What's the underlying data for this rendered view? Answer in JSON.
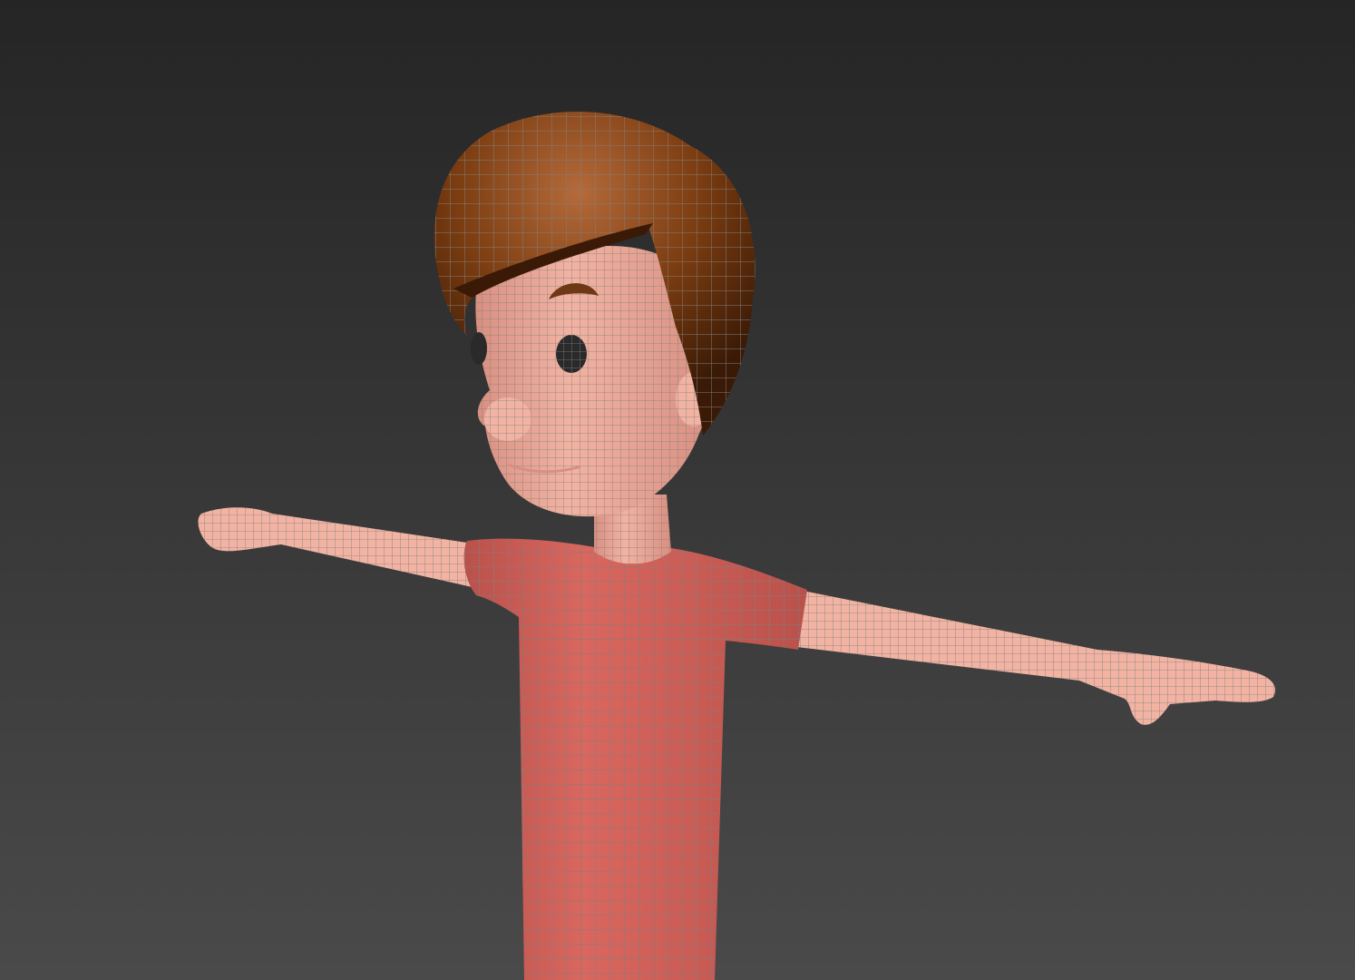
{
  "viewport": {
    "background_top": "#252525",
    "background_bottom": "#4a4a4a",
    "view_mode": "shaded-with-wireframe"
  },
  "model": {
    "pose": "T-pose",
    "colors": {
      "skin": "#f2b3a3",
      "skin_shadow": "#d88f80",
      "shirt": "#d9675f",
      "shirt_shadow": "#b9514b",
      "hair": "#7a3c10",
      "hair_highlight": "#b56a3a",
      "hair_dark": "#3a1a06",
      "eye": "#2a2a2a",
      "eyebrow": "#6e3a16",
      "wireframe": "#7f7f7f"
    }
  }
}
